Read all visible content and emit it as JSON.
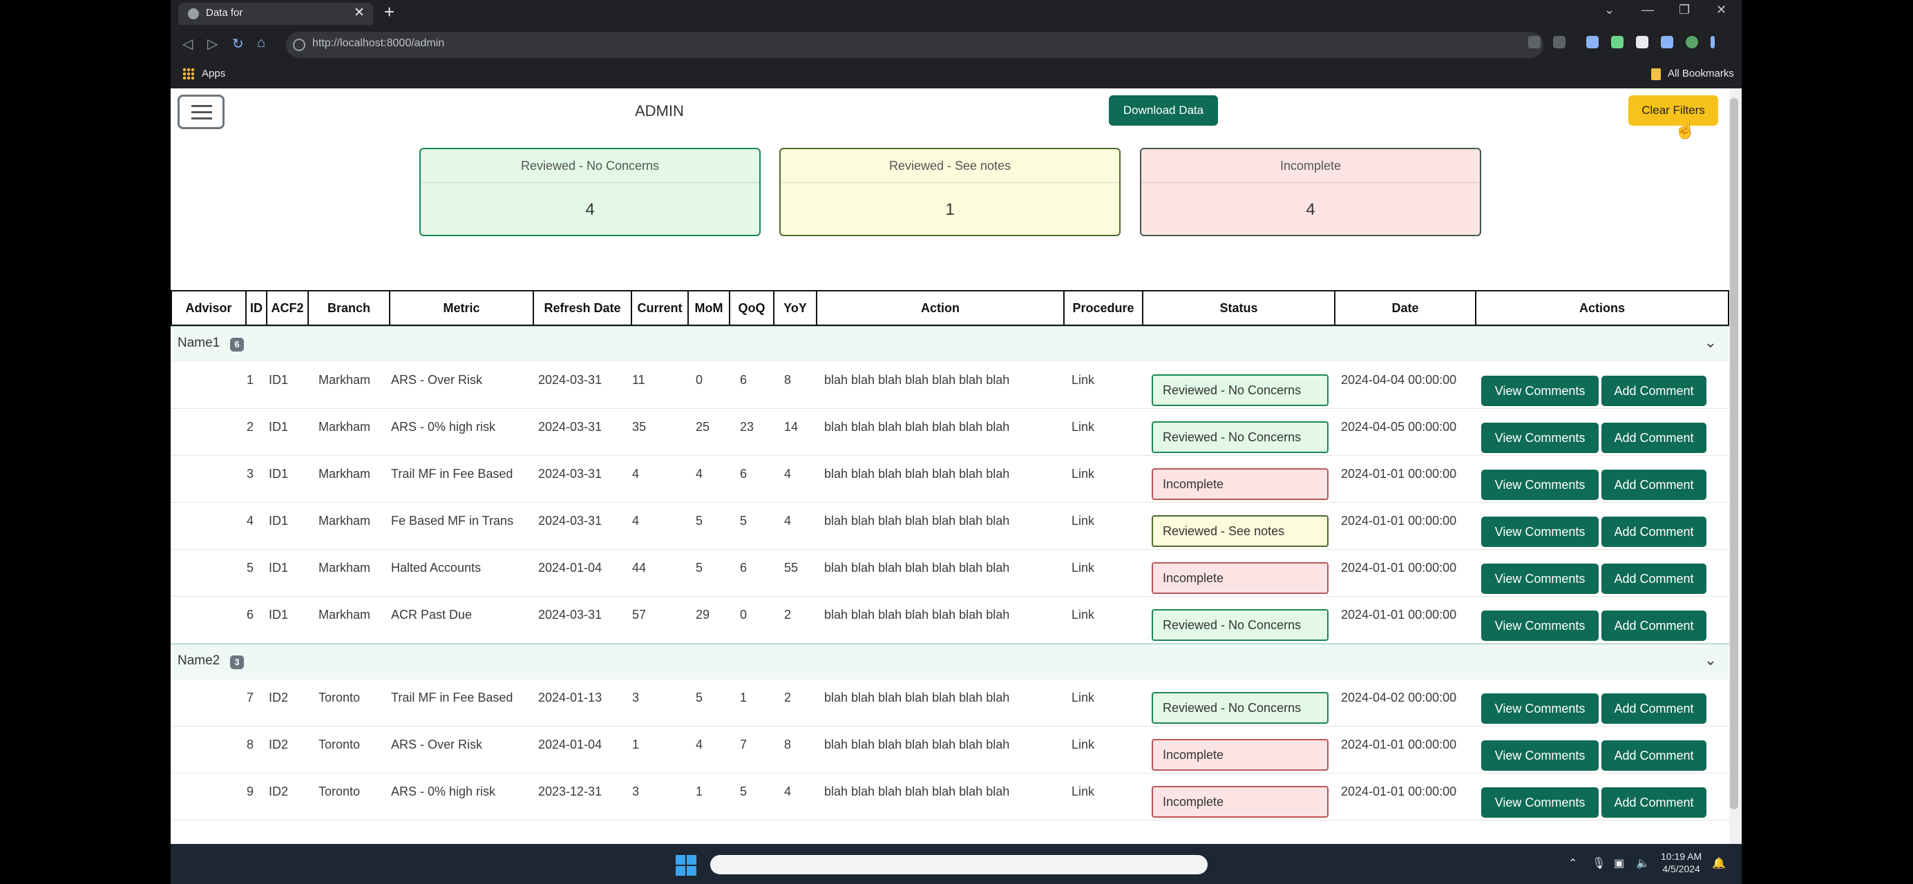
{
  "browser": {
    "tab_title": "Data for",
    "url": "http://localhost:8000/admin",
    "bookmarks": {
      "apps_label": "Apps",
      "all_bookmarks_label": "All Bookmarks"
    }
  },
  "header": {
    "title": "ADMIN",
    "download_label": "Download Data",
    "clear_filters_label": "Clear Filters"
  },
  "summary_cards": [
    {
      "label": "Reviewed - No Concerns",
      "count": "4"
    },
    {
      "label": "Reviewed - See notes",
      "count": "1"
    },
    {
      "label": "Incomplete",
      "count": "4"
    }
  ],
  "table": {
    "columns": [
      "Advisor",
      "ID",
      "ACF2",
      "Branch",
      "Metric",
      "Refresh Date",
      "Current",
      "MoM",
      "QoQ",
      "YoY",
      "Action",
      "Procedure",
      "Status",
      "Date",
      "Actions"
    ],
    "view_comments_label": "View Comments",
    "add_comment_label": "Add Comment",
    "groups": [
      {
        "name": "Name1",
        "count": "6",
        "rows": [
          {
            "id": "1",
            "acf2": "ID1",
            "branch": "Markham",
            "metric": "ARS - Over Risk",
            "refresh": "2024-03-31",
            "current": "11",
            "mom": "0",
            "qoq": "6",
            "yoy": "8",
            "action": "blah blah blah blah blah blah blah",
            "procedure": "Link",
            "status": "Reviewed - No Concerns",
            "date": "2024-04-04 00:00:00"
          },
          {
            "id": "2",
            "acf2": "ID1",
            "branch": "Markham",
            "metric": "ARS - 0% high risk",
            "refresh": "2024-03-31",
            "current": "35",
            "mom": "25",
            "qoq": "23",
            "yoy": "14",
            "action": "blah blah blah blah blah blah blah",
            "procedure": "Link",
            "status": "Reviewed - No Concerns",
            "date": "2024-04-05 00:00:00"
          },
          {
            "id": "3",
            "acf2": "ID1",
            "branch": "Markham",
            "metric": "Trail MF in Fee Based",
            "refresh": "2024-03-31",
            "current": "4",
            "mom": "4",
            "qoq": "6",
            "yoy": "4",
            "action": "blah blah blah blah blah blah blah",
            "procedure": "Link",
            "status": "Incomplete",
            "date": "2024-01-01 00:00:00"
          },
          {
            "id": "4",
            "acf2": "ID1",
            "branch": "Markham",
            "metric": "Fe Based MF in Trans",
            "refresh": "2024-03-31",
            "current": "4",
            "mom": "5",
            "qoq": "5",
            "yoy": "4",
            "action": "blah blah blah blah blah blah blah",
            "procedure": "Link",
            "status": "Reviewed - See notes",
            "date": "2024-01-01 00:00:00"
          },
          {
            "id": "5",
            "acf2": "ID1",
            "branch": "Markham",
            "metric": "Halted Accounts",
            "refresh": "2024-01-04",
            "current": "44",
            "mom": "5",
            "qoq": "6",
            "yoy": "55",
            "action": "blah blah blah blah blah blah blah",
            "procedure": "Link",
            "status": "Incomplete",
            "date": "2024-01-01 00:00:00"
          },
          {
            "id": "6",
            "acf2": "ID1",
            "branch": "Markham",
            "metric": "ACR Past Due",
            "refresh": "2024-03-31",
            "current": "57",
            "mom": "29",
            "qoq": "0",
            "yoy": "2",
            "action": "blah blah blah blah blah blah blah",
            "procedure": "Link",
            "status": "Reviewed - No Concerns",
            "date": "2024-01-01 00:00:00"
          }
        ]
      },
      {
        "name": "Name2",
        "count": "3",
        "rows": [
          {
            "id": "7",
            "acf2": "ID2",
            "branch": "Toronto",
            "metric": "Trail MF in Fee Based",
            "refresh": "2024-01-13",
            "current": "3",
            "mom": "5",
            "qoq": "1",
            "yoy": "2",
            "action": "blah blah blah blah blah blah blah",
            "procedure": "Link",
            "status": "Reviewed - No Concerns",
            "date": "2024-04-02 00:00:00"
          },
          {
            "id": "8",
            "acf2": "ID2",
            "branch": "Toronto",
            "metric": "ARS - Over Risk",
            "refresh": "2024-01-04",
            "current": "1",
            "mom": "4",
            "qoq": "7",
            "yoy": "8",
            "action": "blah blah blah blah blah blah blah",
            "procedure": "Link",
            "status": "Incomplete",
            "date": "2024-01-01 00:00:00"
          },
          {
            "id": "9",
            "acf2": "ID2",
            "branch": "Toronto",
            "metric": "ARS - 0% high risk",
            "refresh": "2023-12-31",
            "current": "3",
            "mom": "1",
            "qoq": "5",
            "yoy": "4",
            "action": "blah blah blah blah blah blah blah",
            "procedure": "Link",
            "status": "Incomplete",
            "date": "2024-01-01 00:00:00"
          }
        ]
      }
    ]
  },
  "taskbar": {
    "time": "10:19 AM",
    "date": "4/5/2024"
  },
  "colors": {
    "primary": "#0e6b55",
    "warning": "#f7c21b",
    "no_concerns": "#e3f8e6",
    "see_notes": "#fcfbdc",
    "incomplete": "#fde4e4"
  }
}
